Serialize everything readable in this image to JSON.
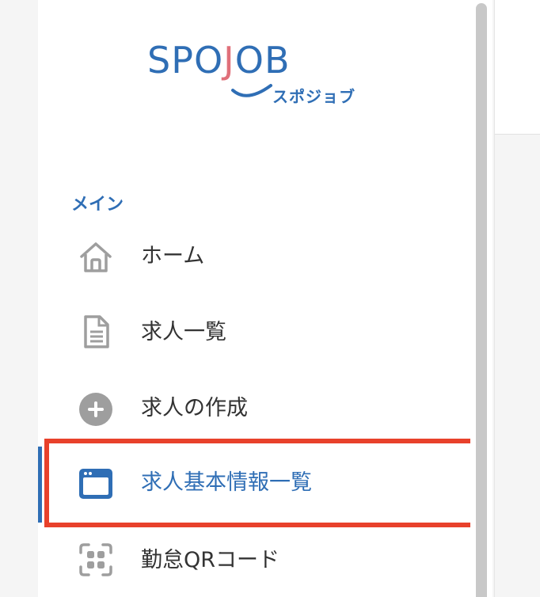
{
  "logo": {
    "brand_prefix": "SPO",
    "brand_j": "J",
    "brand_suffix": "OB",
    "kana": "スポジョブ"
  },
  "sidebar": {
    "section_title": "メイン",
    "items": [
      {
        "label": "ホーム",
        "icon": "home-icon",
        "active": false
      },
      {
        "label": "求人一覧",
        "icon": "document-icon",
        "active": false
      },
      {
        "label": "求人の作成",
        "icon": "plus-circle-icon",
        "active": false
      },
      {
        "label": "求人基本情報一覧",
        "icon": "browser-window-icon",
        "active": true
      },
      {
        "label": "勤怠QRコード",
        "icon": "qr-code-icon",
        "active": false
      }
    ]
  },
  "colors": {
    "accent": "#2f6eb5",
    "brand_pink": "#e0707a",
    "icon_gray": "#9e9e9e",
    "highlight": "#e8412b"
  }
}
